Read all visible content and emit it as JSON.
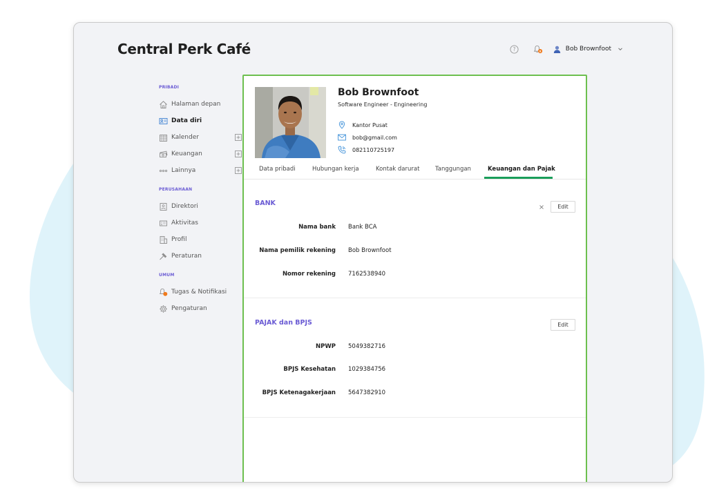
{
  "app": {
    "title": "Central Perk Café"
  },
  "header": {
    "user_name": "Bob Brownfoot"
  },
  "sidebar": {
    "sections": [
      {
        "title": "PRIBADI",
        "items": [
          {
            "label": "Halaman depan",
            "icon": "home-icon"
          },
          {
            "label": "Data diri",
            "icon": "id-card-icon",
            "active": true
          },
          {
            "label": "Kalender",
            "icon": "calendar-icon",
            "expandable": true
          },
          {
            "label": "Keuangan",
            "icon": "money-icon",
            "expandable": true
          },
          {
            "label": "Lainnya",
            "icon": "more-icon",
            "expandable": true
          }
        ]
      },
      {
        "title": "PERUSAHAAN",
        "items": [
          {
            "label": "Direktori",
            "icon": "directory-icon"
          },
          {
            "label": "Aktivitas",
            "icon": "activity-icon"
          },
          {
            "label": "Profil",
            "icon": "building-icon"
          },
          {
            "label": "Peraturan",
            "icon": "gavel-icon"
          }
        ]
      },
      {
        "title": "UMUM",
        "items": [
          {
            "label": "Tugas & Notifikasi",
            "icon": "bell-icon"
          },
          {
            "label": "Pengaturan",
            "icon": "gear-icon"
          }
        ]
      }
    ]
  },
  "profile": {
    "name": "Bob Brownfoot",
    "role": "Software Engineer - Engineering",
    "office": "Kantor Pusat",
    "email": "bob@gmail.com",
    "phone": "082110725197"
  },
  "tabs": [
    {
      "label": "Data pribadi"
    },
    {
      "label": "Hubungan kerja"
    },
    {
      "label": "Kontak darurat"
    },
    {
      "label": "Tanggungan"
    },
    {
      "label": "Keuangan dan Pajak",
      "active": true
    }
  ],
  "bank": {
    "title": "BANK",
    "edit_label": "Edit",
    "fields": [
      {
        "label": "Nama bank",
        "value": "Bank BCA"
      },
      {
        "label": "Nama pemilik rekening",
        "value": "Bob Brownfoot"
      },
      {
        "label": "Nomor rekening",
        "value": "7162538940"
      }
    ]
  },
  "tax": {
    "title": "PAJAK dan BPJS",
    "edit_label": "Edit",
    "fields": [
      {
        "label": "NPWP",
        "value": "5049382716"
      },
      {
        "label": "BPJS Kesehatan",
        "value": "1029384756"
      },
      {
        "label": "BPJS Ketenagakerjaan",
        "value": "5647382910"
      }
    ]
  },
  "colors": {
    "accent": "#6a5bd4",
    "tab_active": "#1a9e5a",
    "card_border": "#6cbf4e",
    "blob": "#dff3fa"
  }
}
